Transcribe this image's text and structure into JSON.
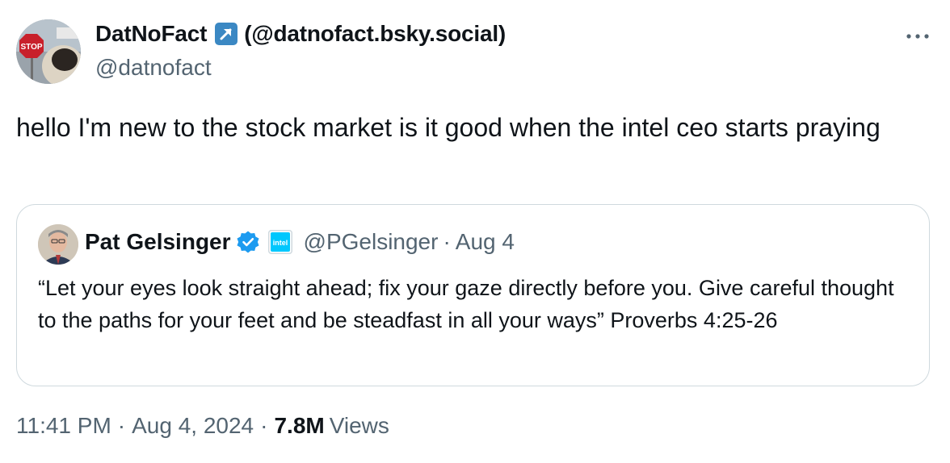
{
  "author": {
    "display_name": "DatNoFact",
    "alt_handle": "(@datnofact.bsky.social)",
    "handle": "@datnofact",
    "avatar_sign_text": "STOP"
  },
  "tweet": {
    "text": "hello I'm new to the stock market is it good when the intel ceo starts praying"
  },
  "quoted": {
    "display_name": "Pat Gelsinger",
    "affiliate_label": "intel",
    "handle": "@PGelsinger",
    "separator": "·",
    "date": "Aug 4",
    "text": "“Let your eyes look straight ahead; fix your gaze directly before you. Give careful thought to the paths for your feet and be steadfast in all your ways” Proverbs 4:25-26"
  },
  "meta": {
    "time": "11:41 PM",
    "separator": "·",
    "date": "Aug 4, 2024",
    "views_count": "7.8M",
    "views_label": "Views"
  },
  "colors": {
    "text": "#0f1419",
    "secondary": "#536471",
    "verified": "#1d9bf0",
    "border": "#cfd9de",
    "arrow_badge": "#3b88c3"
  },
  "icons": {
    "more": "more-horizontal-icon",
    "verified": "verified-badge-icon",
    "arrow": "north-east-arrow-icon"
  }
}
